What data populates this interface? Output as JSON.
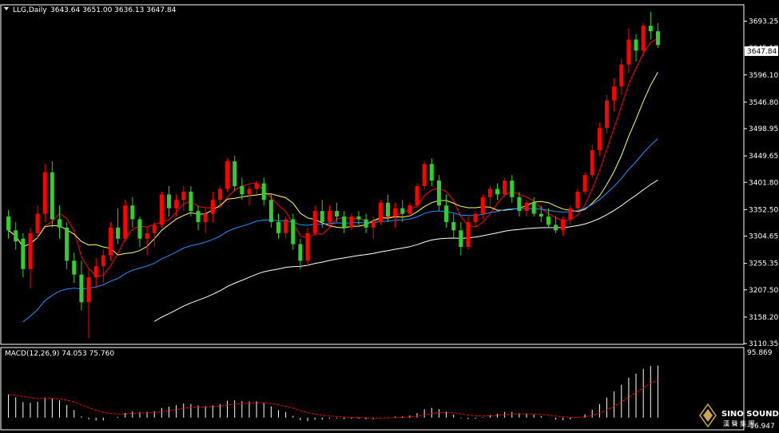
{
  "main_chart": {
    "symbol": "LLG,Daily",
    "ohlc_text": "3643.64 3651.00 3636.13 3647.84",
    "current_price_label": "3647.84",
    "y_ticks": [
      "3693.25",
      "3645.18",
      "3596.10",
      "3546.80",
      "3498.95",
      "3449.65",
      "3401.80",
      "3352.50",
      "3304.65",
      "3255.35",
      "3207.50",
      "3158.20",
      "3110.35"
    ],
    "ylim": [
      3110.35,
      3720
    ]
  },
  "macd_panel": {
    "label": "MACD(12,26,9) 74.053 75.760",
    "top_label": "95.869",
    "bottom_label": "-16.947",
    "ylim": [
      -16.947,
      95.869
    ]
  },
  "watermark": {
    "brand": "SINO SOUND",
    "subtitle": "漢 聲 集 團"
  },
  "colors": {
    "background": "#000000",
    "up_candle": "#ff0000",
    "down_candle": "#32cd32",
    "ma_fast": "#ff0000",
    "ma_mid": "#ffff66",
    "ma_slow": "#1e90ff",
    "ma_long": "#ffffff",
    "ma_extra": "#ff4500",
    "grid_frame": "#ffffff",
    "macd_hist": "#ffffff",
    "macd_signal": "#ff0000"
  },
  "chart_data": {
    "type": "candlestick",
    "title": "LLG,Daily",
    "ylim": [
      3110.35,
      3720
    ],
    "candles": [
      [
        3340,
        3352,
        3300,
        3315
      ],
      [
        3315,
        3330,
        3280,
        3295
      ],
      [
        3300,
        3310,
        3230,
        3245
      ],
      [
        3245,
        3320,
        3210,
        3310
      ],
      [
        3310,
        3360,
        3300,
        3345
      ],
      [
        3345,
        3435,
        3330,
        3420
      ],
      [
        3420,
        3440,
        3320,
        3335
      ],
      [
        3335,
        3360,
        3300,
        3320
      ],
      [
        3320,
        3330,
        3245,
        3260
      ],
      [
        3260,
        3275,
        3220,
        3235
      ],
      [
        3235,
        3260,
        3170,
        3185
      ],
      [
        3185,
        3245,
        3120,
        3230
      ],
      [
        3230,
        3265,
        3210,
        3250
      ],
      [
        3250,
        3280,
        3220,
        3270
      ],
      [
        3270,
        3330,
        3260,
        3320
      ],
      [
        3320,
        3355,
        3290,
        3300
      ],
      [
        3300,
        3370,
        3295,
        3360
      ],
      [
        3360,
        3375,
        3320,
        3335
      ],
      [
        3335,
        3340,
        3285,
        3300
      ],
      [
        3300,
        3320,
        3270,
        3310
      ],
      [
        3310,
        3330,
        3285,
        3325
      ],
      [
        3325,
        3385,
        3320,
        3380
      ],
      [
        3380,
        3395,
        3340,
        3355
      ],
      [
        3355,
        3380,
        3340,
        3370
      ],
      [
        3370,
        3395,
        3350,
        3385
      ],
      [
        3385,
        3395,
        3340,
        3350
      ],
      [
        3350,
        3360,
        3315,
        3330
      ],
      [
        3330,
        3355,
        3310,
        3345
      ],
      [
        3345,
        3385,
        3330,
        3370
      ],
      [
        3370,
        3395,
        3355,
        3390
      ],
      [
        3390,
        3445,
        3385,
        3440
      ],
      [
        3440,
        3450,
        3385,
        3395
      ],
      [
        3395,
        3410,
        3370,
        3380
      ],
      [
        3380,
        3395,
        3360,
        3390
      ],
      [
        3390,
        3405,
        3380,
        3400
      ],
      [
        3400,
        3410,
        3360,
        3370
      ],
      [
        3370,
        3380,
        3320,
        3330
      ],
      [
        3330,
        3345,
        3300,
        3310
      ],
      [
        3310,
        3340,
        3300,
        3335
      ],
      [
        3335,
        3345,
        3280,
        3290
      ],
      [
        3290,
        3300,
        3245,
        3260
      ],
      [
        3260,
        3320,
        3250,
        3310
      ],
      [
        3310,
        3360,
        3305,
        3350
      ],
      [
        3350,
        3370,
        3320,
        3330
      ],
      [
        3330,
        3360,
        3320,
        3350
      ],
      [
        3350,
        3365,
        3330,
        3340
      ],
      [
        3340,
        3350,
        3310,
        3320
      ],
      [
        3320,
        3345,
        3315,
        3340
      ],
      [
        3340,
        3350,
        3325,
        3335
      ],
      [
        3335,
        3345,
        3310,
        3320
      ],
      [
        3320,
        3340,
        3300,
        3330
      ],
      [
        3330,
        3370,
        3325,
        3365
      ],
      [
        3365,
        3380,
        3330,
        3340
      ],
      [
        3340,
        3365,
        3320,
        3355
      ],
      [
        3355,
        3370,
        3330,
        3345
      ],
      [
        3345,
        3365,
        3340,
        3360
      ],
      [
        3360,
        3400,
        3355,
        3395
      ],
      [
        3395,
        3440,
        3390,
        3435
      ],
      [
        3435,
        3445,
        3395,
        3405
      ],
      [
        3405,
        3415,
        3350,
        3360
      ],
      [
        3360,
        3380,
        3320,
        3330
      ],
      [
        3330,
        3345,
        3300,
        3315
      ],
      [
        3315,
        3330,
        3270,
        3285
      ],
      [
        3285,
        3340,
        3280,
        3330
      ],
      [
        3330,
        3350,
        3320,
        3345
      ],
      [
        3345,
        3380,
        3335,
        3375
      ],
      [
        3375,
        3395,
        3360,
        3390
      ],
      [
        3390,
        3400,
        3370,
        3380
      ],
      [
        3380,
        3410,
        3375,
        3405
      ],
      [
        3405,
        3415,
        3365,
        3375
      ],
      [
        3375,
        3385,
        3340,
        3350
      ],
      [
        3350,
        3370,
        3340,
        3365
      ],
      [
        3365,
        3375,
        3340,
        3345
      ],
      [
        3345,
        3360,
        3330,
        3340
      ],
      [
        3340,
        3355,
        3320,
        3325
      ],
      [
        3325,
        3340,
        3310,
        3315
      ],
      [
        3315,
        3340,
        3305,
        3335
      ],
      [
        3335,
        3360,
        3325,
        3355
      ],
      [
        3355,
        3390,
        3350,
        3385
      ],
      [
        3385,
        3420,
        3380,
        3415
      ],
      [
        3415,
        3470,
        3410,
        3460
      ],
      [
        3460,
        3510,
        3450,
        3500
      ],
      [
        3500,
        3560,
        3490,
        3550
      ],
      [
        3550,
        3590,
        3530,
        3575
      ],
      [
        3575,
        3625,
        3560,
        3615
      ],
      [
        3615,
        3680,
        3600,
        3660
      ],
      [
        3660,
        3670,
        3620,
        3640
      ],
      [
        3640,
        3690,
        3630,
        3685
      ],
      [
        3685,
        3710,
        3660,
        3675
      ],
      [
        3675,
        3690,
        3645,
        3650
      ]
    ],
    "macd_histogram_scale": "auto"
  }
}
